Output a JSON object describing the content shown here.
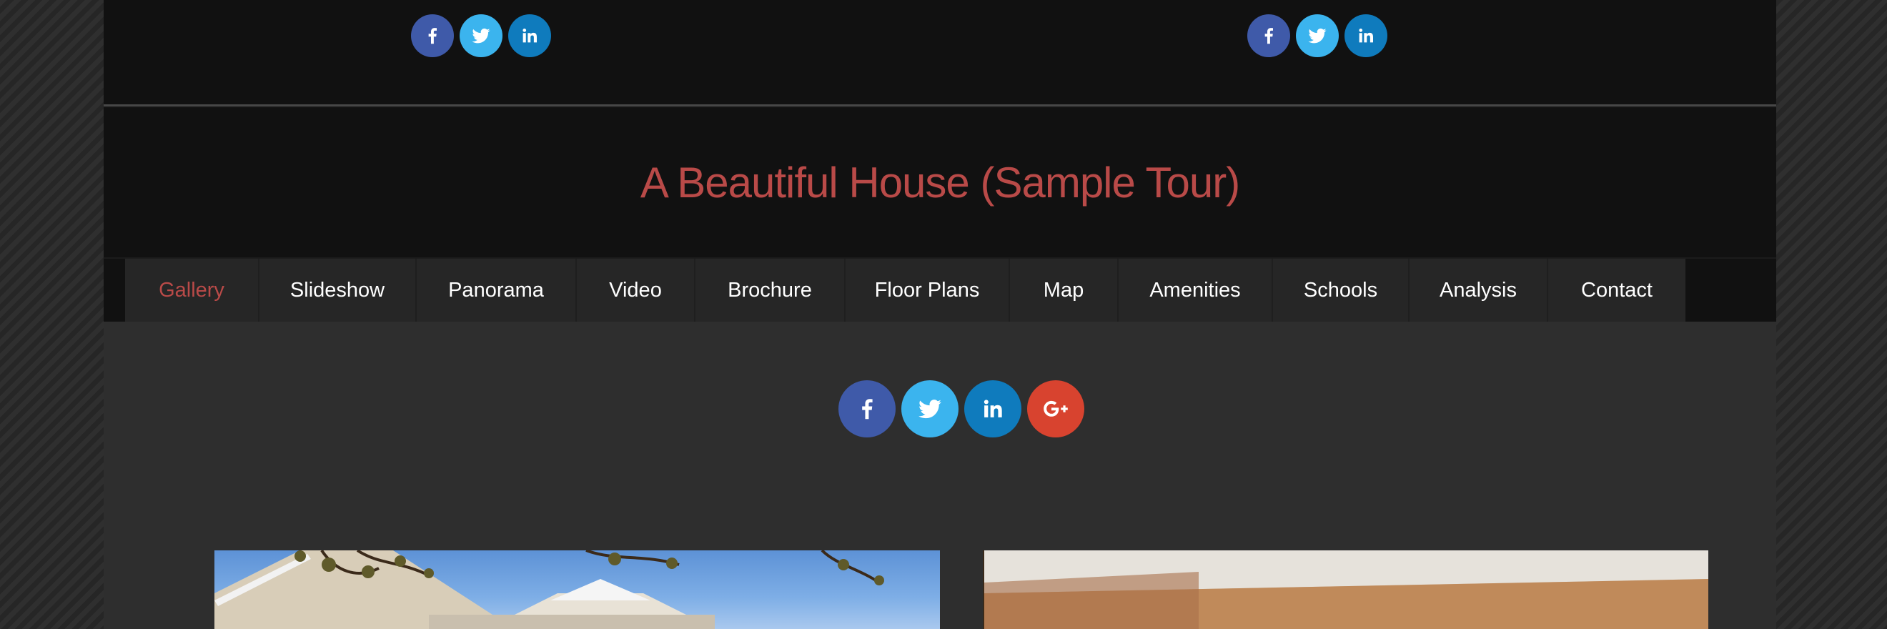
{
  "colors": {
    "accent": "#b94a48",
    "facebook": "#3f5aa9",
    "twitter": "#3bb4ee",
    "linkedin": "#0f7bbd",
    "googleplus": "#d8432f"
  },
  "topbar": {
    "social_left": [
      "facebook-icon",
      "twitter-icon",
      "linkedin-icon"
    ],
    "social_right": [
      "facebook-icon",
      "twitter-icon",
      "linkedin-icon"
    ]
  },
  "header": {
    "title": "A Beautiful House (Sample Tour)"
  },
  "nav": {
    "items": [
      {
        "label": "Gallery",
        "active": true
      },
      {
        "label": "Slideshow"
      },
      {
        "label": "Panorama"
      },
      {
        "label": "Video"
      },
      {
        "label": "Brochure"
      },
      {
        "label": "Floor Plans"
      },
      {
        "label": "Map"
      },
      {
        "label": "Amenities"
      },
      {
        "label": "Schools"
      },
      {
        "label": "Analysis"
      },
      {
        "label": "Contact"
      }
    ]
  },
  "share": {
    "icons": [
      "facebook-icon",
      "twitter-icon",
      "linkedin-icon",
      "google-plus-icon"
    ]
  },
  "gallery": {
    "photos": [
      "house-exterior-photo",
      "interior-room-photo"
    ]
  }
}
